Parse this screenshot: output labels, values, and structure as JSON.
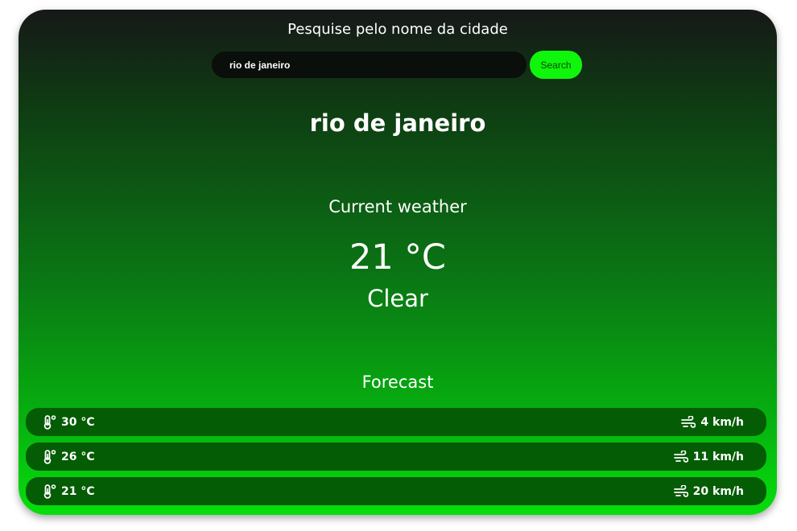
{
  "search": {
    "title": "Pesquise pelo nome da cidade",
    "value": "rio de janeiro",
    "button_label": "Search"
  },
  "city": {
    "name": "rio de janeiro"
  },
  "current": {
    "heading": "Current weather",
    "temperature": "21 °C",
    "condition": "Clear"
  },
  "forecast": {
    "heading": "Forecast",
    "items": [
      {
        "temp": "30 °C",
        "wind": "4 km/h",
        "temp_icon": "thermometer-icon",
        "wind_icon": "wind-icon"
      },
      {
        "temp": "26 °C",
        "wind": "11 km/h",
        "temp_icon": "thermometer-icon",
        "wind_icon": "wind-icon"
      },
      {
        "temp": "21 °C",
        "wind": "20 km/h",
        "temp_icon": "thermometer-icon",
        "wind_icon": "wind-icon"
      }
    ]
  },
  "colors": {
    "accent_button": "#0ff50c",
    "gradient_top": "#161818",
    "gradient_bottom": "#07de0c",
    "forecast_row": "#045c04"
  }
}
